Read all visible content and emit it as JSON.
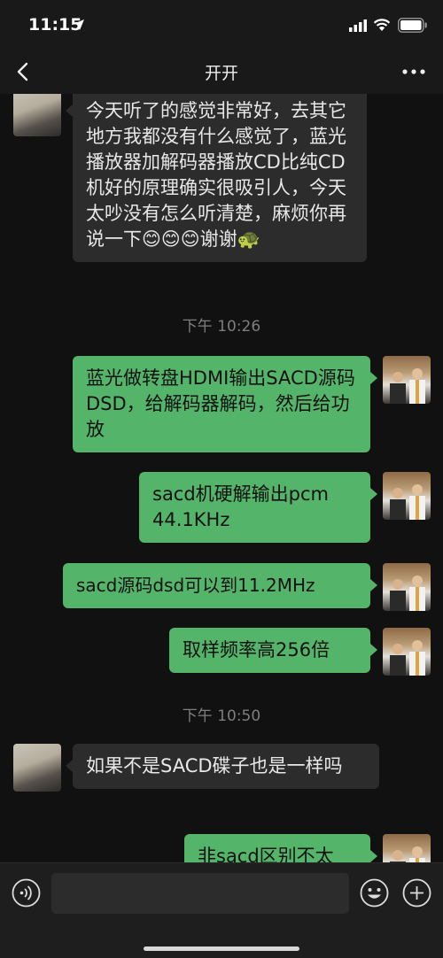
{
  "status_bar": {
    "time": "11:15"
  },
  "nav": {
    "title": "开开"
  },
  "messages": [
    {
      "from": "contact",
      "text": "今天听了的感觉非常好，去其它地方我都没有什么感觉了，蓝光播放器加解码器播放CD比纯CD机好的原理确实很吸引人，今天太吵没有怎么听清楚，麻烦你再说一下😊😊😊谢谢🐢"
    },
    {
      "type": "timestamp",
      "text": "下午 10:26"
    },
    {
      "from": "me",
      "text": "蓝光做转盘HDMI输出SACD源码DSD，给解码器解码，然后给功放"
    },
    {
      "from": "me",
      "text": "sacd机硬解输出pcm 44.1KHz"
    },
    {
      "from": "me",
      "text": "sacd源码dsd可以到11.2MHz"
    },
    {
      "from": "me",
      "text": "取样频率高256倍"
    },
    {
      "type": "timestamp",
      "text": "下午 10:50"
    },
    {
      "from": "contact",
      "text": "如果不是SACD碟子也是一样吗"
    },
    {
      "from": "me",
      "text": "非sacd区别不太"
    }
  ],
  "input": {
    "value": "",
    "placeholder": ""
  },
  "colors": {
    "background": "#111111",
    "bar": "#191919",
    "bubble_incoming": "#2c2c2c",
    "bubble_outgoing": "#54b46a",
    "timestamp_text": "#7e7e7e"
  },
  "icons": [
    "location-arrow-icon",
    "signal-icon",
    "wifi-icon",
    "battery-icon",
    "back-chevron-icon",
    "more-dots-icon",
    "voice-icon",
    "emoji-icon",
    "plus-icon"
  ]
}
